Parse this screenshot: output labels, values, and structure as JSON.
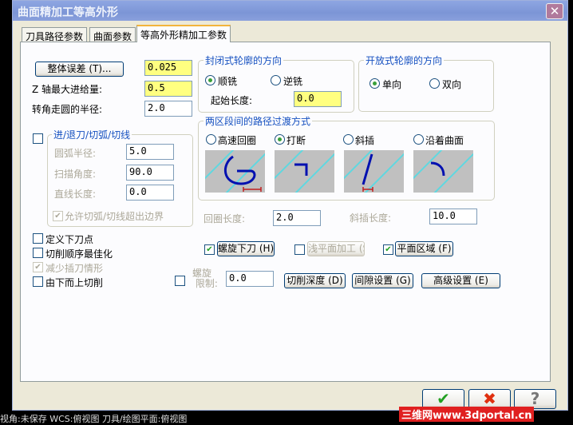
{
  "window": {
    "title": "曲面精加工等高外形",
    "close": "✕"
  },
  "tabs": [
    "刀具路径参数",
    "曲面参数",
    "等高外形精加工参数"
  ],
  "params": {
    "tolerance_button": "整体误差 (T)...",
    "tolerance": "0.025",
    "z_step_label": "Z 轴最大进给量:",
    "z_step": "0.5",
    "corner_label": "转角走圆的半径:",
    "corner": "2.0"
  },
  "closed_dir": {
    "title": "封闭式轮廓的方向",
    "options": [
      "顺铣",
      "逆铣"
    ],
    "selected": 0,
    "start_label": "起始长度:",
    "start": "0.0"
  },
  "open_dir": {
    "title": "开放式轮廓的方向",
    "options": [
      "单向",
      "双向"
    ],
    "selected": 0
  },
  "entry": {
    "title": "进/退刀/切弧/切线",
    "checked": false,
    "arc_radius_label": "圆弧半径:",
    "arc_radius": "5.0",
    "sweep_label": "扫描角度:",
    "sweep": "90.0",
    "line_label": "直线长度:",
    "line": "0.0",
    "allow_label": "允许切弧/切线超出边界"
  },
  "transition": {
    "title": "两区段间的路径过渡方式",
    "options": [
      "高速回圈",
      "打断",
      "斜插",
      "沿着曲面"
    ],
    "selected": 1,
    "loop_label": "回圈长度:",
    "loop": "2.0",
    "ramp_label": "斜插长度:",
    "ramp": "10.0"
  },
  "options": [
    "定义下刀点",
    "切削顺序最佳化",
    "减少插刀情形",
    "由下而上切削"
  ],
  "buttons": {
    "helix": "螺旋下刀 (H)",
    "flat": "浅平面加工 (S)",
    "flat_area": "平面区域 (F)",
    "helix_limit_label1": "螺旋",
    "helix_limit_label2": "限制:",
    "helix_limit": "0.0",
    "depth": "切削深度 (D)",
    "gap": "间隙设置 (G)",
    "advanced": "高级设置 (E)"
  },
  "footer": {
    "ok": "✔",
    "cancel": "✖",
    "help": "?"
  },
  "status": "视角:未保存    WCS:俯视图    刀具/绘图平面:俯视图",
  "watermark": "三维网www.3dportal.cn"
}
